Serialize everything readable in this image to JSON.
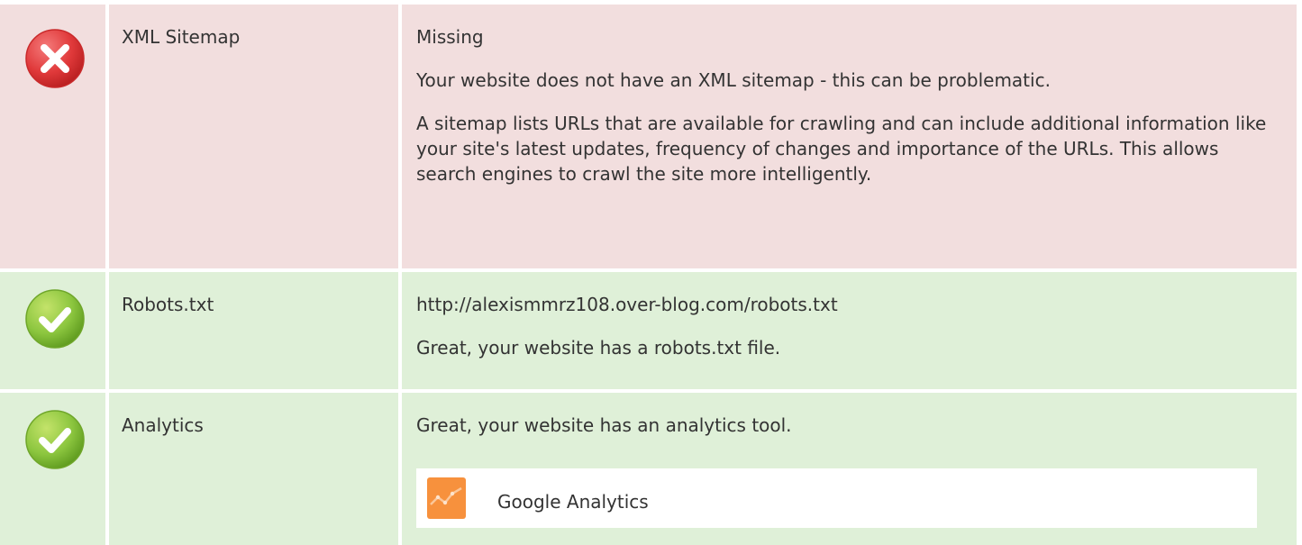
{
  "rows": [
    {
      "status": "error",
      "name": "XML Sitemap",
      "value": "Missing",
      "message": "Your website does not have an XML sitemap - this can be problematic.",
      "detail": "A sitemap lists URLs that are available for crawling and can include additional information like your site's latest updates, frequency of changes and importance of the URLs. This allows search engines to crawl the site more intelligently."
    },
    {
      "status": "success",
      "name": "Robots.txt",
      "value": "http://alexismmrz108.over-blog.com/robots.txt",
      "message": "Great, your website has a robots.txt file."
    },
    {
      "status": "success",
      "name": "Analytics",
      "message": "Great, your website has an analytics tool.",
      "tool": {
        "name": "Google Analytics",
        "icon": "google-analytics-icon"
      }
    }
  ],
  "colors": {
    "error_bg": "#f2dede",
    "success_bg": "#dff0d8",
    "error_icon": "#e0393a",
    "success_icon": "#8cc63f"
  }
}
